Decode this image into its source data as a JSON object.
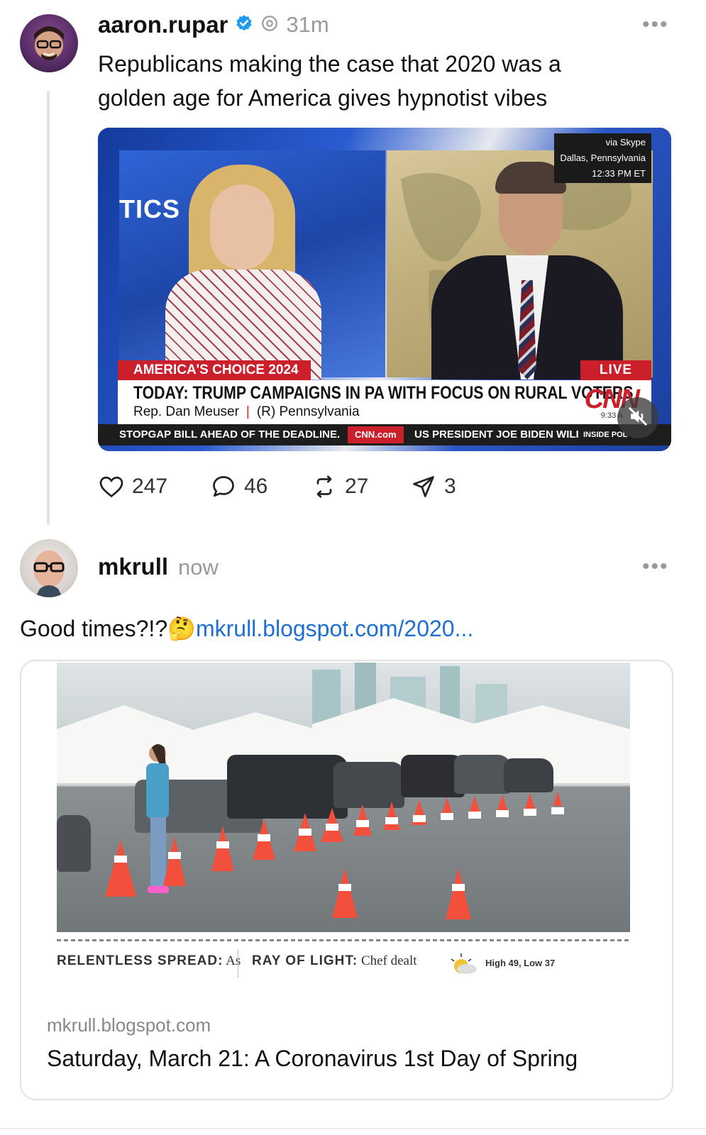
{
  "post1": {
    "username": "aaron.rupar",
    "time": "31m",
    "verified": true,
    "text_line1": "Republicans making the case that 2020 was a",
    "text_line2": "golden age for America gives hypnotist vibes",
    "video": {
      "tics": "TICS",
      "skype_line1": "via Skype",
      "skype_line2": "Dallas, Pennsylvania",
      "skype_line3": "12:33 PM ET",
      "chyron_top": "AMERICA'S CHOICE 2024",
      "live": "LIVE",
      "headline": "TODAY: TRUMP CAMPAIGNS IN PA WITH FOCUS ON RURAL VOTERS",
      "sub_name": "Rep. Dan Meuser",
      "sub_party": "(R) Pennsylvania",
      "logo": "CNN",
      "clock": "9:33 A",
      "ticker_left": "STOPGAP BILL AHEAD OF THE DEADLINE.",
      "ticker_brand": "CNN.com",
      "ticker_right": "US PRESIDENT JOE BIDEN WILI",
      "ticker_tag": "INSIDE POL",
      "muted": true
    },
    "actions": {
      "likes": "247",
      "replies": "46",
      "reposts": "27",
      "shares": "3"
    }
  },
  "post2": {
    "username": "mkrull",
    "time": "now",
    "text": "Good times?!?",
    "emoji": "🤔",
    "link_text": "mkrull.blogspot.com/2020...",
    "card": {
      "news_col1_bold": "RELENTLESS SPREAD:",
      "news_col1_rest": " As",
      "news_col2_bold": "RAY OF LIGHT:",
      "news_col2_rest": " Chef dealt",
      "weather": "High 49, Low 37",
      "domain": "mkrull.blogspot.com",
      "title": "Saturday, March 21: A Coronavirus 1st Day of Spring"
    }
  },
  "colors": {
    "link": "#1d6fd8",
    "verified": "#1d9bf0",
    "cnn_red": "#cc1f2c"
  }
}
